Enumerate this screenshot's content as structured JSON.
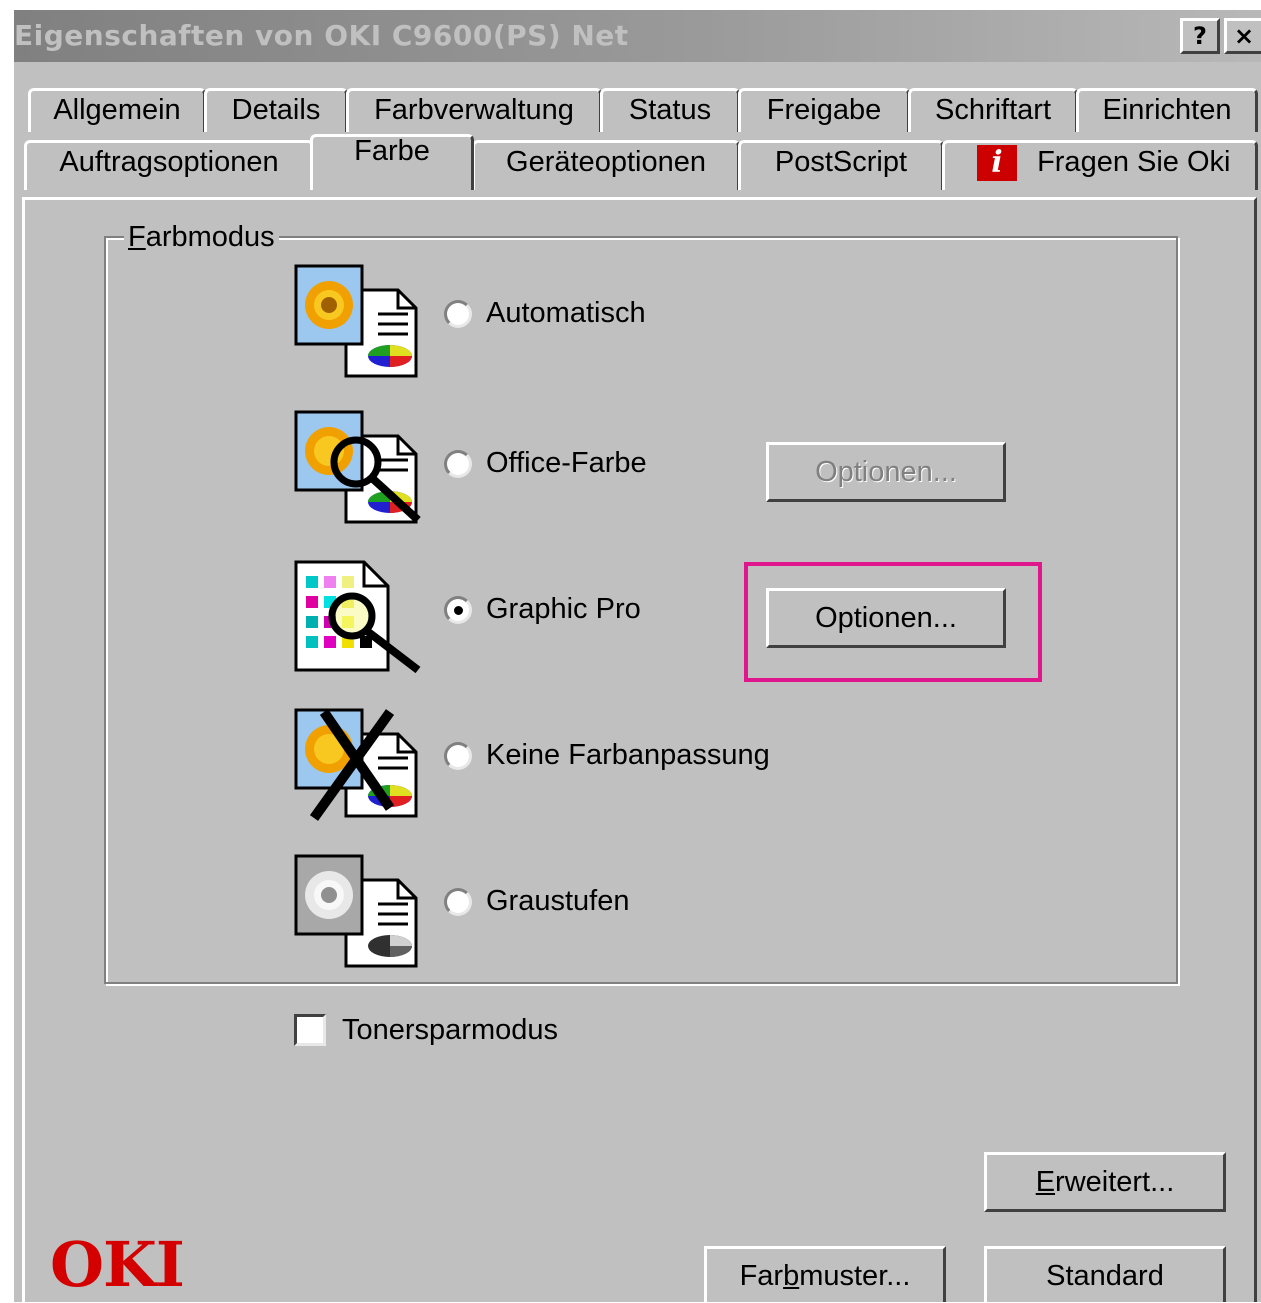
{
  "window": {
    "title": "Eigenschaften von OKI C9600(PS) Net",
    "help_label": "?",
    "close_label": "×"
  },
  "tabs": {
    "row1": [
      "Allgemein",
      "Details",
      "Farbverwaltung",
      "Status",
      "Freigabe",
      "Schriftart",
      "Einrichten"
    ],
    "row2": [
      "Auftragsoptionen",
      "Farbe",
      "Geräteoptionen",
      "PostScript",
      "Fragen Sie Oki"
    ],
    "active": "Farbe",
    "info_icon": "info-icon",
    "info_glyph": "i"
  },
  "group": {
    "label_u": "F",
    "label_rest": "arbmodus"
  },
  "modes": [
    {
      "label": "Automatisch",
      "selected": false,
      "icon": "document-color-icon"
    },
    {
      "label": "Office-Farbe",
      "selected": false,
      "icon": "document-magnifier-icon"
    },
    {
      "label": "Graphic Pro",
      "selected": true,
      "icon": "cmyk-magnifier-icon"
    },
    {
      "label": "Keine Farbanpassung",
      "selected": false,
      "icon": "document-crossed-icon"
    },
    {
      "label": "Graustufen",
      "selected": false,
      "icon": "document-grayscale-icon"
    }
  ],
  "buttons": {
    "office_options": "Optionen...",
    "office_options_enabled": false,
    "graphic_options": "Optionen...",
    "erweitert_u": "E",
    "erweitert_rest": "rweitert...",
    "farbmuster_pre": "Far",
    "farbmuster_u": "b",
    "farbmuster_post": "muster...",
    "standard": "Standard"
  },
  "toner": {
    "label": "Tonersparmodus",
    "checked": false
  },
  "logo": "OKI",
  "colors": {
    "face": "#c0c0c0",
    "highlight_box": "#e0168c",
    "logo": "#d40000",
    "info_icon": "#cc0000"
  }
}
